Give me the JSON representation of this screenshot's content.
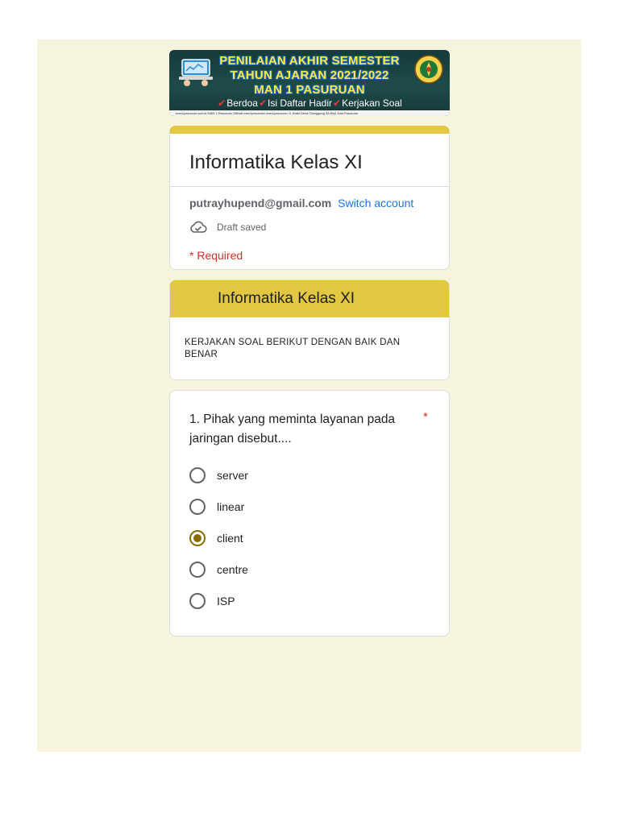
{
  "banner": {
    "line1": "PENILAIAN AKHIR SEMESTER",
    "line2": "TAHUN AJARAN 2021/2022",
    "line3": "MAN 1 PASURUAN",
    "slogans": [
      "Berdoa",
      "Isi Daftar Hadir",
      "Kerjakan Soal"
    ],
    "footer_text": "man1pasuruan.sch.id   MAN 1 Pasuruan Official   man1pasuruan   man1pasuruan   Jl. Balai Desa Glanggang 3A Beji, Kab.Pasuruan"
  },
  "header": {
    "title": "Informatika Kelas XI",
    "account_email": "putrayhupend@gmail.com",
    "switch_account": "Switch account",
    "draft_status": "Draft saved",
    "required_note": "* Required"
  },
  "section": {
    "title": "Informatika Kelas XI",
    "description": "KERJAKAN SOAL BERIKUT DENGAN BAIK DAN BENAR"
  },
  "question": {
    "text": "1. Pihak yang meminta layanan pada jaringan disebut....",
    "required_mark": "*",
    "options": [
      {
        "label": "server",
        "selected": false
      },
      {
        "label": "linear",
        "selected": false
      },
      {
        "label": "client",
        "selected": true
      },
      {
        "label": "centre",
        "selected": false
      },
      {
        "label": "ISP",
        "selected": false
      }
    ]
  },
  "colors": {
    "page_background": "#f7f4dd",
    "theme_accent": "#e1c742",
    "selected_radio": "#8a6d00",
    "link": "#1a73e8",
    "required": "#d93025"
  }
}
